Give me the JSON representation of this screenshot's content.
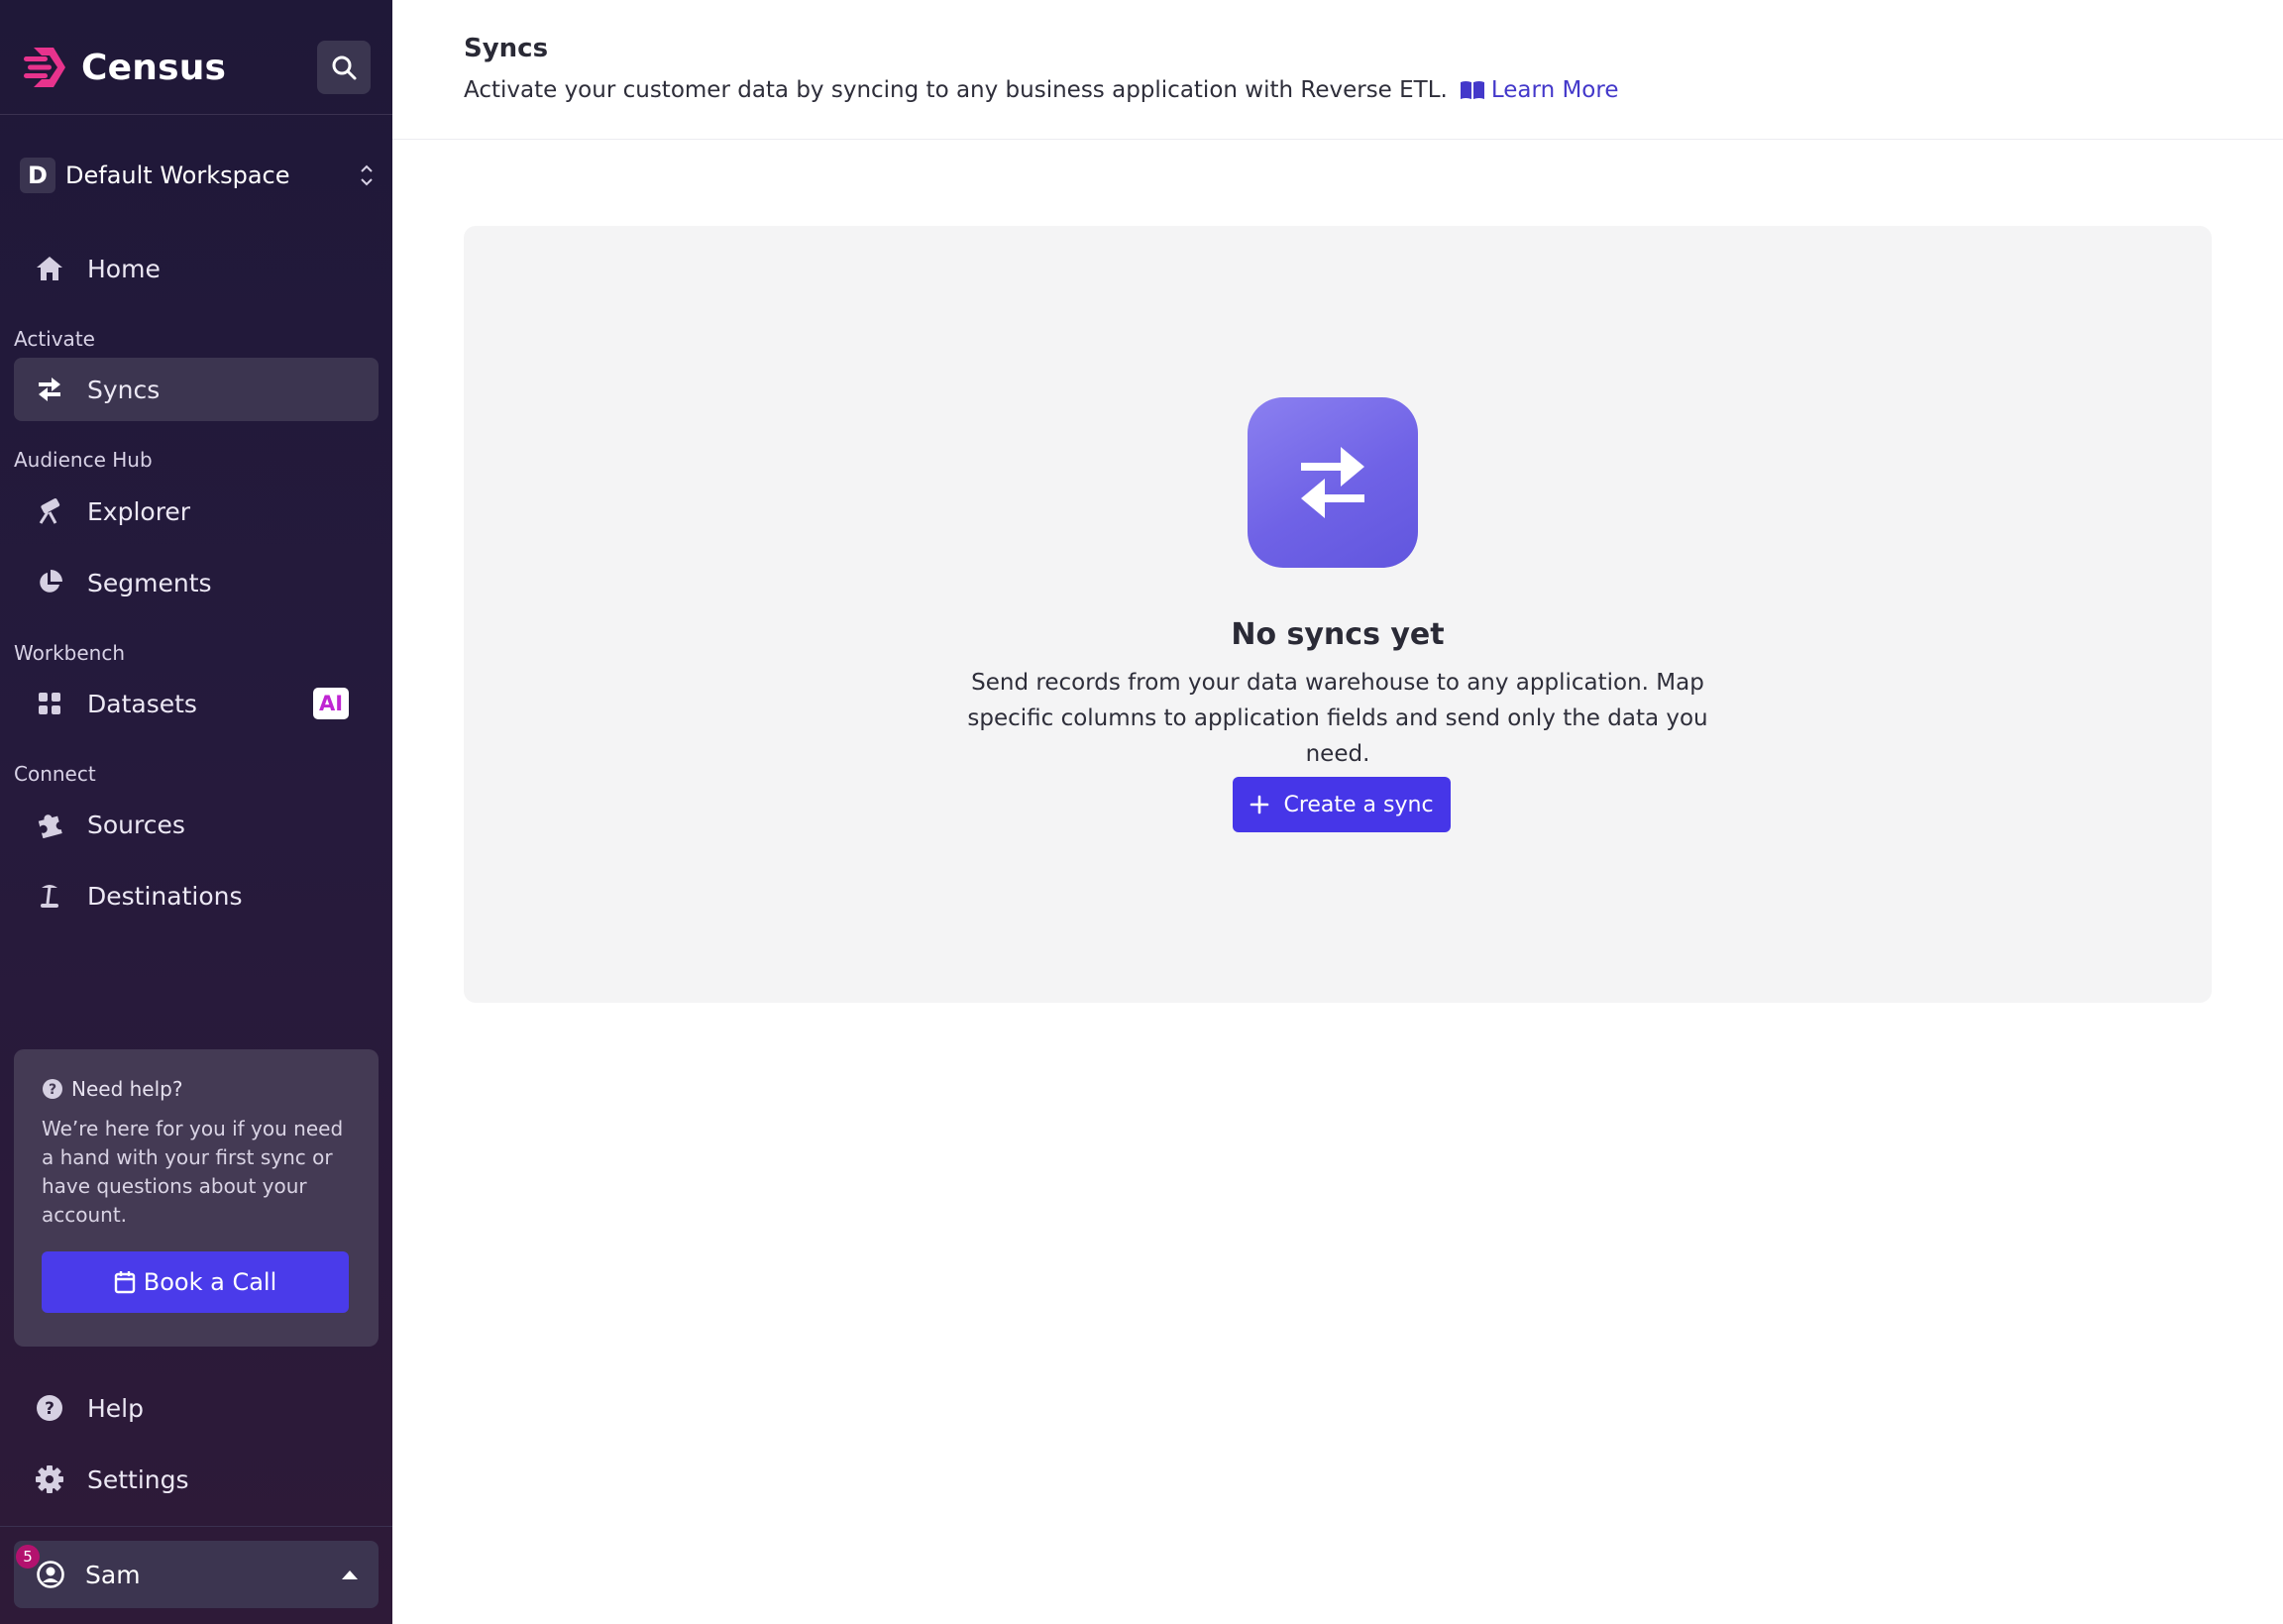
{
  "brand": {
    "name": "Census"
  },
  "workspace": {
    "badge": "D",
    "name": "Default Workspace"
  },
  "nav": {
    "home": "Home",
    "sections": {
      "activate": "Activate",
      "audience_hub": "Audience Hub",
      "workbench": "Workbench",
      "connect": "Connect"
    },
    "syncs": "Syncs",
    "explorer": "Explorer",
    "segments": "Segments",
    "datasets": "Datasets",
    "datasets_badge": "AI",
    "sources": "Sources",
    "destinations": "Destinations",
    "help": "Help",
    "settings": "Settings"
  },
  "help_card": {
    "title": "Need help?",
    "text": "We’re here for you if you need a hand with your first sync or have questions about your account.",
    "button": "Book a Call"
  },
  "user": {
    "name": "Sam",
    "notifications": "5"
  },
  "page": {
    "title": "Syncs",
    "subtitle": "Activate your customer data by syncing to any business application with Reverse ETL.",
    "learn_more": "Learn More"
  },
  "empty_state": {
    "title": "No syncs yet",
    "text": "Send records from your data warehouse to any application. Map specific columns to application fields and send only the data you need.",
    "button": "Create a sync"
  },
  "colors": {
    "accent": "#4636e8",
    "link": "#4338ca",
    "logo_pink": "#e8338d",
    "ai_badge": "#c026d3",
    "notification": "#b3126e"
  },
  "icons": {
    "logo": "census-logo-icon",
    "search": "search-icon",
    "home": "home-icon",
    "syncs": "sync-arrows-icon",
    "explorer": "telescope-icon",
    "segments": "pie-chart-icon",
    "datasets": "grid-icon",
    "sources": "puzzle-icon",
    "destinations": "beach-icon",
    "help": "question-circle-icon",
    "settings": "gear-icon",
    "user": "user-circle-icon"
  }
}
